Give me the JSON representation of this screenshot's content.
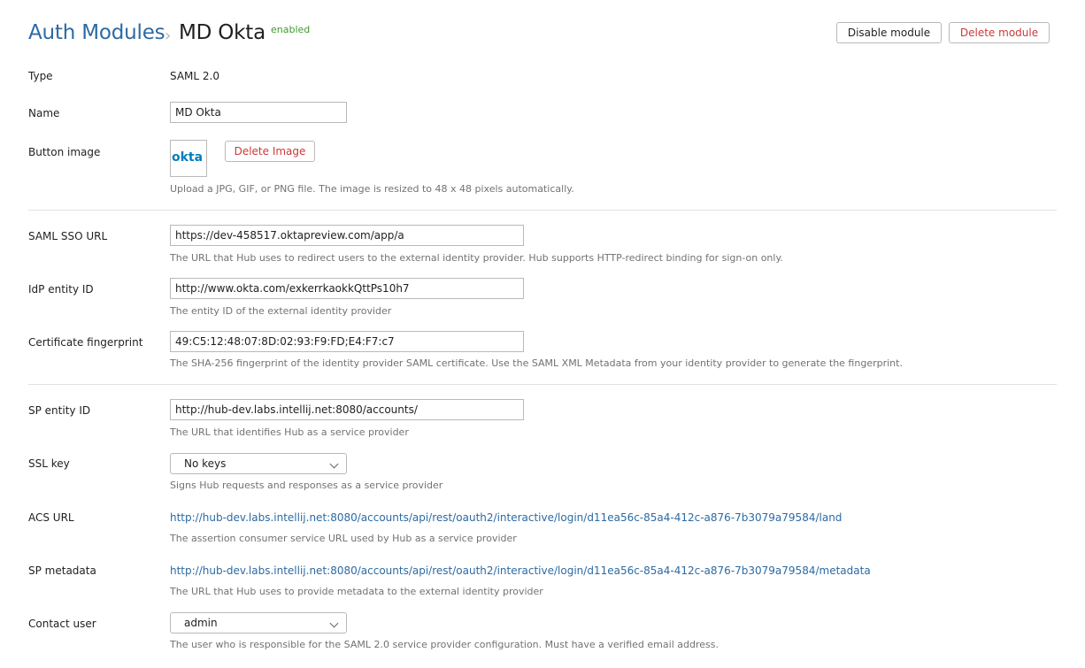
{
  "header": {
    "breadcrumb_parent": "Auth Modules",
    "breadcrumb_sep": "›",
    "title": "MD Okta",
    "status": "enabled",
    "disable_label": "Disable module",
    "delete_label": "Delete module"
  },
  "fields": {
    "type": {
      "label": "Type",
      "value": "SAML 2.0"
    },
    "name": {
      "label": "Name",
      "value": "MD Okta"
    },
    "button_image": {
      "label": "Button image",
      "logo_text": "okta",
      "delete_label": "Delete Image",
      "hint": "Upload a JPG, GIF, or PNG file. The image is resized to 48 x 48 pixels automatically."
    },
    "saml_sso_url": {
      "label": "SAML SSO URL",
      "value": "https://dev-458517.oktapreview.com/app/a",
      "hint": "The URL that Hub uses to redirect users to the external identity provider. Hub supports HTTP-redirect binding for sign-on only."
    },
    "idp_entity_id": {
      "label": "IdP entity ID",
      "value": "http://www.okta.com/exkerrkaokkQttPs10h7",
      "hint": "The entity ID of the external identity provider"
    },
    "cert_fingerprint": {
      "label": "Certificate fingerprint",
      "value": "49:C5:12:48:07:8D:02:93:F9:FD;E4:F7:c7",
      "hint": "The SHA-256 fingerprint of the identity provider SAML certificate. Use the SAML XML Metadata from your identity provider to generate the fingerprint."
    },
    "sp_entity_id": {
      "label": "SP entity ID",
      "value": "http://hub-dev.labs.intellij.net:8080/accounts/",
      "hint": "The URL that identifies Hub as a service provider"
    },
    "ssl_key": {
      "label": "SSL key",
      "value": "No keys",
      "hint": "Signs Hub requests and responses as a service provider"
    },
    "acs_url": {
      "label": "ACS URL",
      "value": "http://hub-dev.labs.intellij.net:8080/accounts/api/rest/oauth2/interactive/login/d11ea56c-85a4-412c-a876-7b3079a79584/land",
      "hint": "The assertion consumer service URL used by Hub as a service provider"
    },
    "sp_metadata": {
      "label": "SP metadata",
      "value": "http://hub-dev.labs.intellij.net:8080/accounts/api/rest/oauth2/interactive/login/d11ea56c-85a4-412c-a876-7b3079a79584/metadata",
      "hint": "The URL that Hub uses to provide metadata to the external identity provider"
    },
    "contact_user": {
      "label": "Contact user",
      "value": "admin",
      "hint": "The user who is responsible for the SAML 2.0 service provider configuration. Must have a verified email address."
    }
  },
  "colors": {
    "link": "#2d6aa3",
    "danger": "#c93a3a",
    "enabled": "#3f9a2e",
    "okta_brand": "#007dc1"
  }
}
